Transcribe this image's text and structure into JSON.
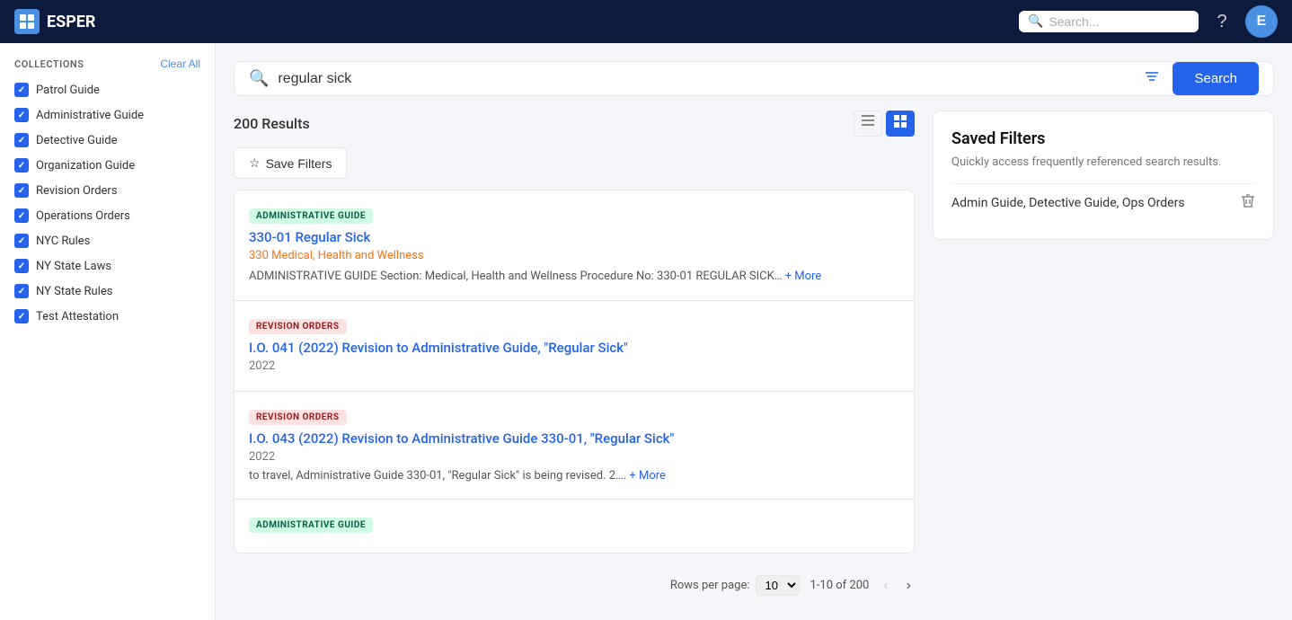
{
  "topnav": {
    "logo_text": "ESPER",
    "logo_icon": "TF",
    "search_placeholder": "Search...",
    "avatar_label": "E",
    "help_icon": "?"
  },
  "sidebar": {
    "section_title": "Collections",
    "clear_all_label": "Clear All",
    "items": [
      {
        "id": "patrol-guide",
        "label": "Patrol Guide",
        "checked": true
      },
      {
        "id": "admin-guide",
        "label": "Administrative Guide",
        "checked": true
      },
      {
        "id": "detective-guide",
        "label": "Detective Guide",
        "checked": true
      },
      {
        "id": "org-guide",
        "label": "Organization Guide",
        "checked": true
      },
      {
        "id": "revision-orders",
        "label": "Revision Orders",
        "checked": true
      },
      {
        "id": "operations-orders",
        "label": "Operations Orders",
        "checked": true
      },
      {
        "id": "nyc-rules",
        "label": "NYC Rules",
        "checked": true
      },
      {
        "id": "ny-state-laws",
        "label": "NY State Laws",
        "checked": true
      },
      {
        "id": "ny-state-rules",
        "label": "NY State Rules",
        "checked": true
      },
      {
        "id": "test-attestation",
        "label": "Test Attestation",
        "checked": true
      }
    ]
  },
  "search": {
    "query": "regular sick",
    "placeholder": "Search...",
    "button_label": "Search",
    "results_count": "200 Results",
    "save_filters_label": "Save Filters"
  },
  "results": [
    {
      "tag": "ADMINISTRATIVE GUIDE",
      "tag_type": "admin",
      "title": "330-01 Regular Sick",
      "subtitle": "330 Medical, Health and Wellness",
      "excerpt": "ADMINISTRATIVE GUIDE Section: Medical, Health and Wellness Procedure No: 330-01 REGULAR SICK… + More",
      "year": ""
    },
    {
      "tag": "REVISION ORDERS",
      "tag_type": "revision",
      "title": "I.O. 041 (2022) Revision to Administrative Guide, \"Regular Sick\"",
      "subtitle": "",
      "excerpt": "",
      "year": "2022"
    },
    {
      "tag": "REVISION ORDERS",
      "tag_type": "revision",
      "title": "I.O. 043 (2022) Revision to Administrative Guide 330-01, \"Regular Sick\"",
      "subtitle": "",
      "excerpt": "to travel, Administrative Guide 330-01, \"Regular Sick\" is being revised. 2…. + More",
      "year": "2022"
    },
    {
      "tag": "ADMINISTRATIVE GUIDE",
      "tag_type": "admin",
      "title": "",
      "subtitle": "",
      "excerpt": "",
      "year": ""
    }
  ],
  "pagination": {
    "rows_per_page_label": "Rows per page:",
    "rows_value": "10",
    "page_info": "1-10 of 200"
  },
  "saved_filters": {
    "title": "Saved Filters",
    "description": "Quickly access frequently referenced search results.",
    "items": [
      {
        "name": "Admin Guide, Detective Guide, Ops Orders"
      }
    ]
  }
}
